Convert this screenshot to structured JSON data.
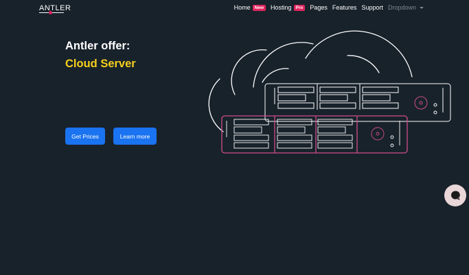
{
  "brand": {
    "name": "ANTLER"
  },
  "nav": {
    "items": [
      {
        "label": "Home",
        "badge": "New"
      },
      {
        "label": "Hosting",
        "badge": "Pro"
      },
      {
        "label": "Pages"
      },
      {
        "label": "Features"
      },
      {
        "label": "Support"
      },
      {
        "label": "Dropdown"
      }
    ]
  },
  "hero": {
    "title": "Antler offer:",
    "subtitle": "Cloud Server",
    "buttons": {
      "get_prices": "Get Prices",
      "learn_more": "Learn more"
    }
  },
  "colors": {
    "background": "#18222b",
    "accent_yellow": "#f6cf1c",
    "button_blue": "#1a73f0",
    "badge_pink": "#e0245e",
    "server_pink": "#d24d8b"
  },
  "icons": {
    "chat": "chat-bubble-icon",
    "dropdown": "chevron-down-icon"
  }
}
